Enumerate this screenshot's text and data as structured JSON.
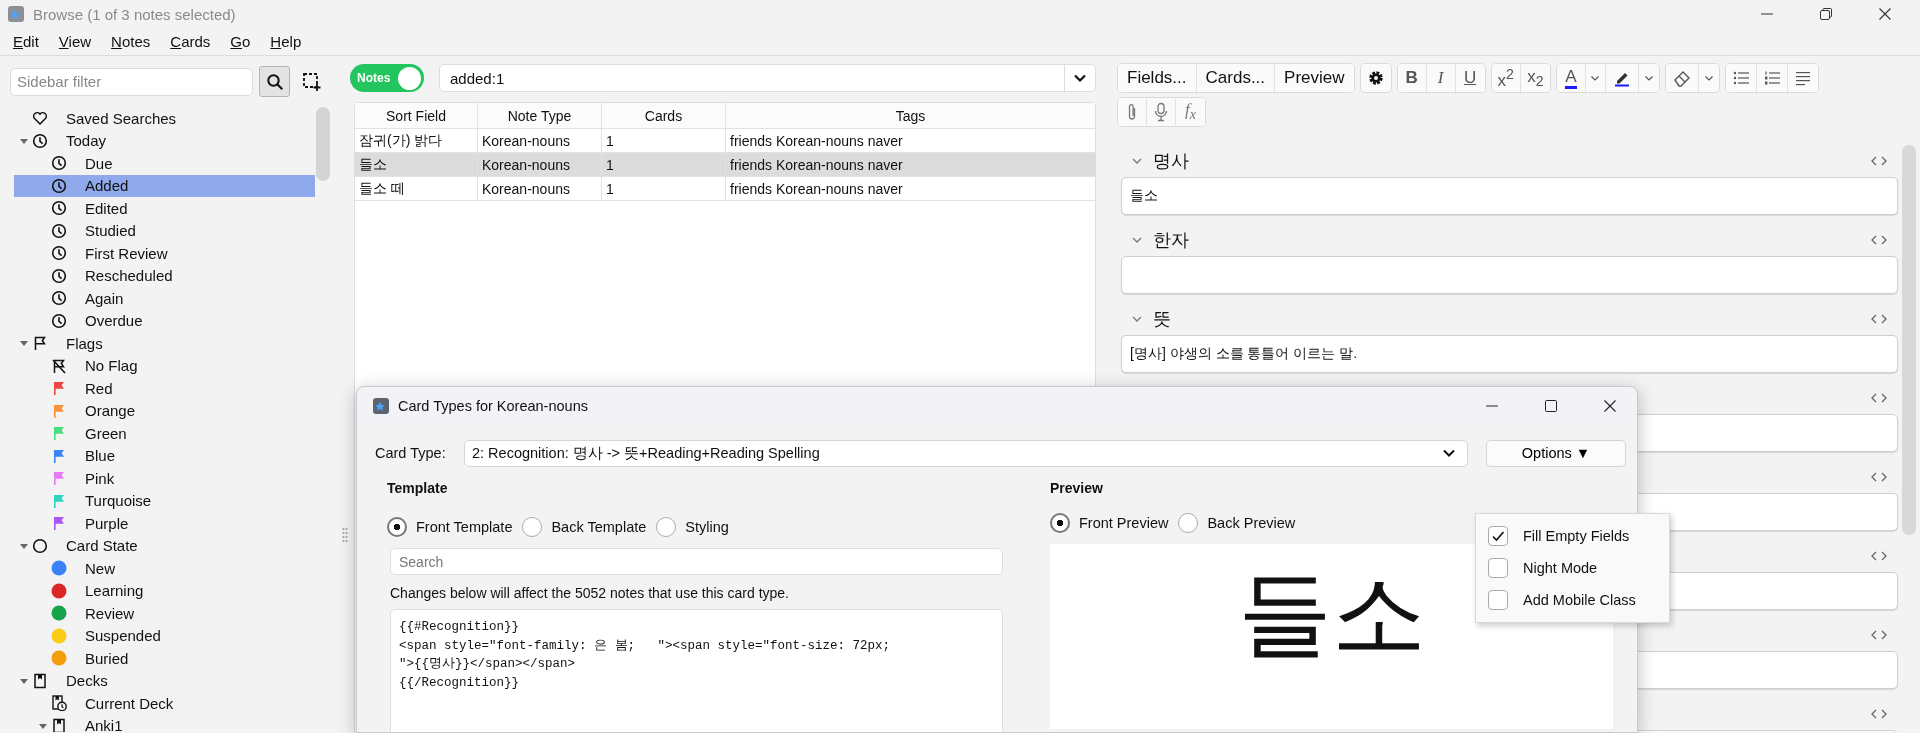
{
  "window": {
    "title": "Browse (1 of 3 notes selected)"
  },
  "menu": [
    {
      "label": "Edit"
    },
    {
      "label": "View"
    },
    {
      "label": "Notes"
    },
    {
      "label": "Cards"
    },
    {
      "label": "Go"
    },
    {
      "label": "Help"
    }
  ],
  "sidebar": {
    "filter": {
      "placeholder": "Sidebar filter"
    },
    "tree": [
      {
        "label": "Saved Searches",
        "kind": "heart",
        "selected": false
      },
      {
        "label": "Today",
        "kind": "clock",
        "selected": false,
        "expanded": true,
        "children": [
          {
            "label": "Due",
            "kind": "clock",
            "selected": false
          },
          {
            "label": "Added",
            "kind": "clock",
            "selected": true
          },
          {
            "label": "Edited",
            "kind": "clock",
            "selected": false
          },
          {
            "label": "Studied",
            "kind": "clock",
            "selected": false
          },
          {
            "label": "First Review",
            "kind": "clock",
            "selected": false
          },
          {
            "label": "Rescheduled",
            "kind": "clock",
            "selected": false
          },
          {
            "label": "Again",
            "kind": "clock",
            "selected": false
          },
          {
            "label": "Overdue",
            "kind": "clock",
            "selected": false
          }
        ]
      },
      {
        "label": "Flags",
        "kind": "flag",
        "selected": false,
        "expanded": true,
        "children": [
          {
            "label": "No Flag",
            "kind": "noflag",
            "selected": false
          },
          {
            "label": "Red",
            "kind": "flag",
            "color": "#ef4444",
            "selected": false
          },
          {
            "label": "Orange",
            "kind": "flag",
            "color": "#fb923c",
            "selected": false
          },
          {
            "label": "Green",
            "kind": "flag",
            "color": "#4ade80",
            "selected": false
          },
          {
            "label": "Blue",
            "kind": "flag",
            "color": "#3b82f6",
            "selected": false
          },
          {
            "label": "Pink",
            "kind": "flag",
            "color": "#e879f9",
            "selected": false
          },
          {
            "label": "Turquoise",
            "kind": "flag",
            "color": "#2dd4bf",
            "selected": false
          },
          {
            "label": "Purple",
            "kind": "flag",
            "color": "#a855f7",
            "selected": false
          }
        ]
      },
      {
        "label": "Card State",
        "kind": "circle",
        "selected": false,
        "expanded": true,
        "children": [
          {
            "label": "New",
            "kind": "dot",
            "color": "#3b82f6",
            "selected": false
          },
          {
            "label": "Learning",
            "kind": "dot",
            "color": "#dc2626",
            "selected": false
          },
          {
            "label": "Review",
            "kind": "dot",
            "color": "#16a34a",
            "selected": false
          },
          {
            "label": "Suspended",
            "kind": "dot",
            "color": "#facc15",
            "selected": false
          },
          {
            "label": "Buried",
            "kind": "dot",
            "color": "#f59e0b",
            "selected": false
          }
        ]
      },
      {
        "label": "Decks",
        "kind": "deck",
        "selected": false,
        "expanded": true,
        "children": [
          {
            "label": "Current Deck",
            "kind": "current-deck",
            "selected": false
          },
          {
            "label": "Anki1",
            "kind": "deck",
            "selected": false,
            "expanded": true
          }
        ]
      }
    ]
  },
  "browser": {
    "mode_toggle": {
      "label": "Notes",
      "on": true
    },
    "search": {
      "value": "added:1"
    },
    "table": {
      "columns": [
        "Sort Field",
        "Note Type",
        "Cards",
        "Tags"
      ],
      "rows": [
        {
          "cells": [
            "잠귀(가) 밝다",
            "Korean-nouns",
            "1",
            "friends Korean-nouns naver"
          ],
          "selected": false
        },
        {
          "cells": [
            "들소",
            "Korean-nouns",
            "1",
            "friends Korean-nouns naver"
          ],
          "selected": true
        },
        {
          "cells": [
            "들소 떼",
            "Korean-nouns",
            "1",
            "friends Korean-nouns naver"
          ],
          "selected": false
        }
      ]
    }
  },
  "editor": {
    "toolbar": [
      {
        "groups": [
          {
            "buttons": [
              {
                "kind": "text",
                "label": "Fields..."
              },
              {
                "kind": "text",
                "label": "Cards..."
              },
              {
                "kind": "text",
                "label": "Preview"
              }
            ]
          },
          {
            "buttons": [
              {
                "kind": "gear"
              }
            ]
          },
          {
            "buttons": [
              {
                "kind": "bold",
                "label": "B"
              },
              {
                "kind": "italic",
                "label": "I"
              },
              {
                "kind": "underline",
                "label": "U"
              }
            ]
          },
          {
            "buttons": [
              {
                "kind": "script",
                "label": "x$^{2}$"
              },
              {
                "kind": "script",
                "label": "x$_{2}$"
              }
            ]
          },
          {
            "buttons": [
              {
                "kind": "textcolor",
                "label": "A"
              },
              {
                "kind": "dropdown"
              },
              {
                "kind": "highlight"
              },
              {
                "kind": "dropdown"
              }
            ]
          },
          {
            "buttons": [
              {
                "kind": "eraser"
              },
              {
                "kind": "dropdown"
              }
            ]
          },
          {
            "buttons": [
              {
                "kind": "bullets"
              },
              {
                "kind": "numbers"
              },
              {
                "kind": "align"
              }
            ]
          }
        ]
      },
      {
        "groups": [
          {
            "buttons": [
              {
                "kind": "clip"
              },
              {
                "kind": "mic"
              },
              {
                "kind": "formula",
                "label": "f$_{x}$"
              }
            ]
          }
        ]
      }
    ],
    "fields": [
      {
        "label": "명사",
        "value": "들소",
        "expanded": true
      },
      {
        "label": "한자",
        "expanded": true
      },
      {
        "label": "뜻",
        "value": "[명사] 야생의 소를 통틀어 이르는 말.",
        "expanded": true
      },
      {
        "expanded": true
      },
      {
        "expanded": true
      },
      {
        "expanded": true
      },
      {
        "expanded": true
      },
      {
        "expanded": true
      }
    ]
  },
  "dialog": {
    "title": "Card Types for Korean-nouns",
    "card_type_label": "Card Type:",
    "card_type": "2: Recognition: 명사 -> 뜻+Reading+Reading Spelling",
    "options_button": "Options ▼",
    "template": {
      "heading": "Template",
      "radios": [
        {
          "label": "Front Template",
          "selected": true
        },
        {
          "label": "Back Template",
          "selected": false
        },
        {
          "label": "Styling",
          "selected": false
        }
      ],
      "search": {
        "placeholder": "Search"
      },
      "notice": "Changes below will affect the 5052 notes that use this card type.",
      "code_lines": [
        "{{#Recognition}}",
        "<span style=\"font-family: 은 봄;   \"><span style=\"font-size: 72px;",
        "\">{{명사}}</span></span>",
        "{{/Recognition}}"
      ]
    },
    "preview": {
      "heading": "Preview",
      "radios": [
        {
          "label": "Front Preview",
          "selected": true
        },
        {
          "label": "Back Preview",
          "selected": false
        }
      ],
      "text": "들소"
    },
    "options_menu": [
      {
        "label": "Fill Empty Fields",
        "checked": true
      },
      {
        "label": "Night Mode",
        "checked": false
      },
      {
        "label": "Add Mobile Class",
        "checked": false
      }
    ]
  }
}
